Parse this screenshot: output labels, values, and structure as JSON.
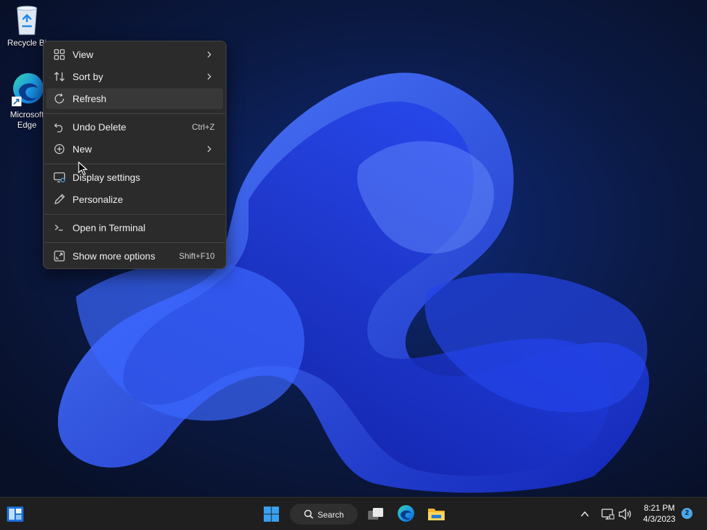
{
  "desktop": {
    "icons": [
      {
        "label": "Recycle Bin",
        "shown": "Recycle Bi"
      },
      {
        "label_line1": "Microsoft",
        "shown_line1": "Microsoft",
        "label_line2": "Edge"
      }
    ]
  },
  "context_menu": {
    "items": [
      {
        "label": "View",
        "icon": "grid-icon",
        "submenu": true
      },
      {
        "label": "Sort by",
        "icon": "sort-icon",
        "submenu": true
      },
      {
        "label": "Refresh",
        "icon": "refresh-icon",
        "highlighted": true
      },
      {
        "label": "Undo Delete",
        "icon": "undo-icon",
        "shortcut": "Ctrl+Z"
      },
      {
        "label": "New",
        "icon": "plus-circle-icon",
        "submenu": true
      },
      {
        "label": "Display settings",
        "icon": "display-icon"
      },
      {
        "label": "Personalize",
        "icon": "pen-icon"
      },
      {
        "label": "Open in Terminal",
        "icon": "terminal-icon"
      },
      {
        "label": "Show more options",
        "icon": "expand-icon",
        "shortcut": "Shift+F10"
      }
    ]
  },
  "taskbar": {
    "search_label": "Search",
    "time": "8:21 PM",
    "date": "4/3/2023",
    "notification_count": "2"
  },
  "colors": {
    "menu_bg": "#2b2b2b",
    "taskbar_bg": "#1f1f1f",
    "wallpaper_blue": "#1e3cff",
    "accent": "#4aa8e8"
  }
}
